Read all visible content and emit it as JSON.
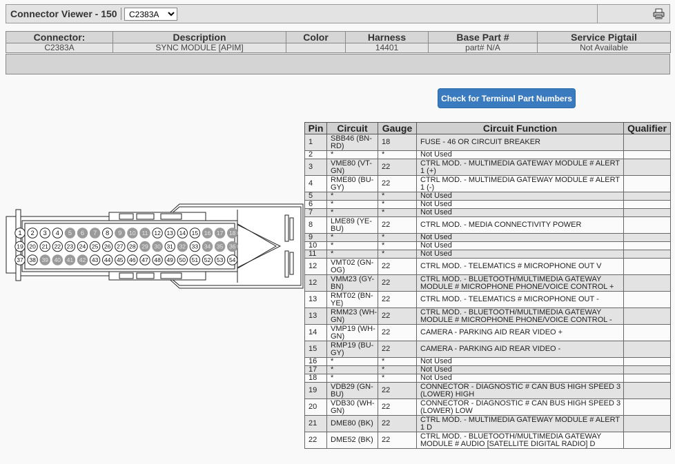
{
  "header": {
    "title": "Connector Viewer - 150",
    "connector_select": {
      "selected": "C2383A",
      "options": [
        "C2383A"
      ]
    },
    "print_icon": "printer-icon"
  },
  "info_table": {
    "headers": [
      "Connector:",
      "Description",
      "Color",
      "Harness",
      "Base Part #",
      "Service Pigtail"
    ],
    "row": [
      "C2383A",
      "SYNC MODULE [APIM]",
      "",
      "14401",
      "part# N/A",
      "Not Available"
    ]
  },
  "terminal_button": "Check for Terminal Part Numbers",
  "connector_diagram": {
    "rows": [
      {
        "pins": [
          "1",
          "2",
          "3",
          "4",
          "5",
          "6",
          "7",
          "8",
          "9",
          "10",
          "11",
          "12",
          "13",
          "14",
          "15",
          "16",
          "17",
          "18"
        ],
        "filled": [
          false,
          false,
          false,
          false,
          true,
          true,
          true,
          false,
          true,
          true,
          true,
          false,
          false,
          false,
          false,
          true,
          true,
          true
        ]
      },
      {
        "pins": [
          "19",
          "20",
          "21",
          "22",
          "23",
          "24",
          "25",
          "26",
          "27",
          "28",
          "29",
          "30",
          "31",
          "32",
          "33",
          "34",
          "35",
          "36"
        ],
        "filled": [
          false,
          false,
          false,
          false,
          false,
          false,
          false,
          false,
          false,
          false,
          true,
          true,
          false,
          true,
          false,
          true,
          true,
          true
        ]
      },
      {
        "pins": [
          "37",
          "38",
          "39",
          "40",
          "41",
          "42",
          "43",
          "44",
          "45",
          "46",
          "47",
          "48",
          "49",
          "50",
          "51",
          "52",
          "53",
          "54"
        ],
        "filled": [
          false,
          false,
          true,
          true,
          true,
          true,
          false,
          false,
          false,
          false,
          false,
          false,
          false,
          false,
          false,
          false,
          false,
          false
        ]
      }
    ]
  },
  "pin_table": {
    "headers": [
      "Pin",
      "Circuit",
      "Gauge",
      "Circuit Function",
      "Qualifier"
    ],
    "rows": [
      {
        "pin": "1",
        "circuit": "SBB46 (BN-RD)",
        "gauge": "18",
        "function": "FUSE - 46 OR CIRCUIT BREAKER",
        "qualifier": ""
      },
      {
        "pin": "2",
        "circuit": "*",
        "gauge": "*",
        "function": "Not Used",
        "qualifier": ""
      },
      {
        "pin": "3",
        "circuit": "VME80 (VT-GN)",
        "gauge": "22",
        "function": "CTRL MOD. - MULTIMEDIA GATEWAY MODULE # ALERT 1 (+)",
        "qualifier": ""
      },
      {
        "pin": "4",
        "circuit": "RME80 (BU-GY)",
        "gauge": "22",
        "function": "CTRL MOD. - MULTIMEDIA GATEWAY MODULE # ALERT 1 (-)",
        "qualifier": ""
      },
      {
        "pin": "5",
        "circuit": "*",
        "gauge": "*",
        "function": "Not Used",
        "qualifier": ""
      },
      {
        "pin": "6",
        "circuit": "*",
        "gauge": "*",
        "function": "Not Used",
        "qualifier": ""
      },
      {
        "pin": "7",
        "circuit": "*",
        "gauge": "*",
        "function": "Not Used",
        "qualifier": ""
      },
      {
        "pin": "8",
        "circuit": "LME89 (YE-BU)",
        "gauge": "22",
        "function": "CTRL MOD. - MEDIA CONNECTIVITY POWER",
        "qualifier": ""
      },
      {
        "pin": "9",
        "circuit": "*",
        "gauge": "*",
        "function": "Not Used",
        "qualifier": ""
      },
      {
        "pin": "10",
        "circuit": "*",
        "gauge": "*",
        "function": "Not Used",
        "qualifier": ""
      },
      {
        "pin": "11",
        "circuit": "*",
        "gauge": "*",
        "function": "Not Used",
        "qualifier": ""
      },
      {
        "pin": "12",
        "circuit": "VMT02 (GN-OG)",
        "gauge": "22",
        "function": "CTRL MOD. - TELEMATICS # MICROPHONE OUT V",
        "qualifier": ""
      },
      {
        "pin": "12",
        "circuit": "VMM23 (GY-BN)",
        "gauge": "22",
        "function": "CTRL MOD. - BLUETOOTH/MULTIMEDIA GATEWAY MODULE # MICROPHONE PHONE/VOICE CONTROL +",
        "qualifier": ""
      },
      {
        "pin": "13",
        "circuit": "RMT02 (BN-YE)",
        "gauge": "22",
        "function": "CTRL MOD. - TELEMATICS # MICROPHONE OUT -",
        "qualifier": ""
      },
      {
        "pin": "13",
        "circuit": "RMM23 (WH-GN)",
        "gauge": "22",
        "function": "CTRL MOD. - BLUETOOTH/MULTIMEDIA GATEWAY MODULE # MICROPHONE PHONE/VOICE CONTROL -",
        "qualifier": ""
      },
      {
        "pin": "14",
        "circuit": "VMP19 (WH-GN)",
        "gauge": "22",
        "function": "CAMERA - PARKING AID REAR VIDEO +",
        "qualifier": ""
      },
      {
        "pin": "15",
        "circuit": "RMP19 (BU-GY)",
        "gauge": "22",
        "function": "CAMERA - PARKING AID REAR VIDEO -",
        "qualifier": ""
      },
      {
        "pin": "16",
        "circuit": "*",
        "gauge": "*",
        "function": "Not Used",
        "qualifier": ""
      },
      {
        "pin": "17",
        "circuit": "*",
        "gauge": "*",
        "function": "Not Used",
        "qualifier": ""
      },
      {
        "pin": "18",
        "circuit": "*",
        "gauge": "*",
        "function": "Not Used",
        "qualifier": ""
      },
      {
        "pin": "19",
        "circuit": "VDB29 (GN-BU)",
        "gauge": "22",
        "function": "CONNECTOR - DIAGNOSTIC # CAN BUS HIGH SPEED 3 (LOWER) HIGH",
        "qualifier": ""
      },
      {
        "pin": "20",
        "circuit": "VDB30 (WH-GN)",
        "gauge": "22",
        "function": "CONNECTOR - DIAGNOSTIC # CAN BUS HIGH SPEED 3 (LOWER) LOW",
        "qualifier": ""
      },
      {
        "pin": "21",
        "circuit": "DME80 (BK)",
        "gauge": "22",
        "function": "CTRL MOD. - MULTIMEDIA GATEWAY MODULE # ALERT 1 D",
        "qualifier": ""
      },
      {
        "pin": "22",
        "circuit": "DME52 (BK)",
        "gauge": "22",
        "function": "CTRL MOD. - BLUETOOTH/MULTIMEDIA GATEWAY MODULE # AUDIO [SATELLITE DIGITAL RADIO] D",
        "qualifier": ""
      }
    ]
  }
}
